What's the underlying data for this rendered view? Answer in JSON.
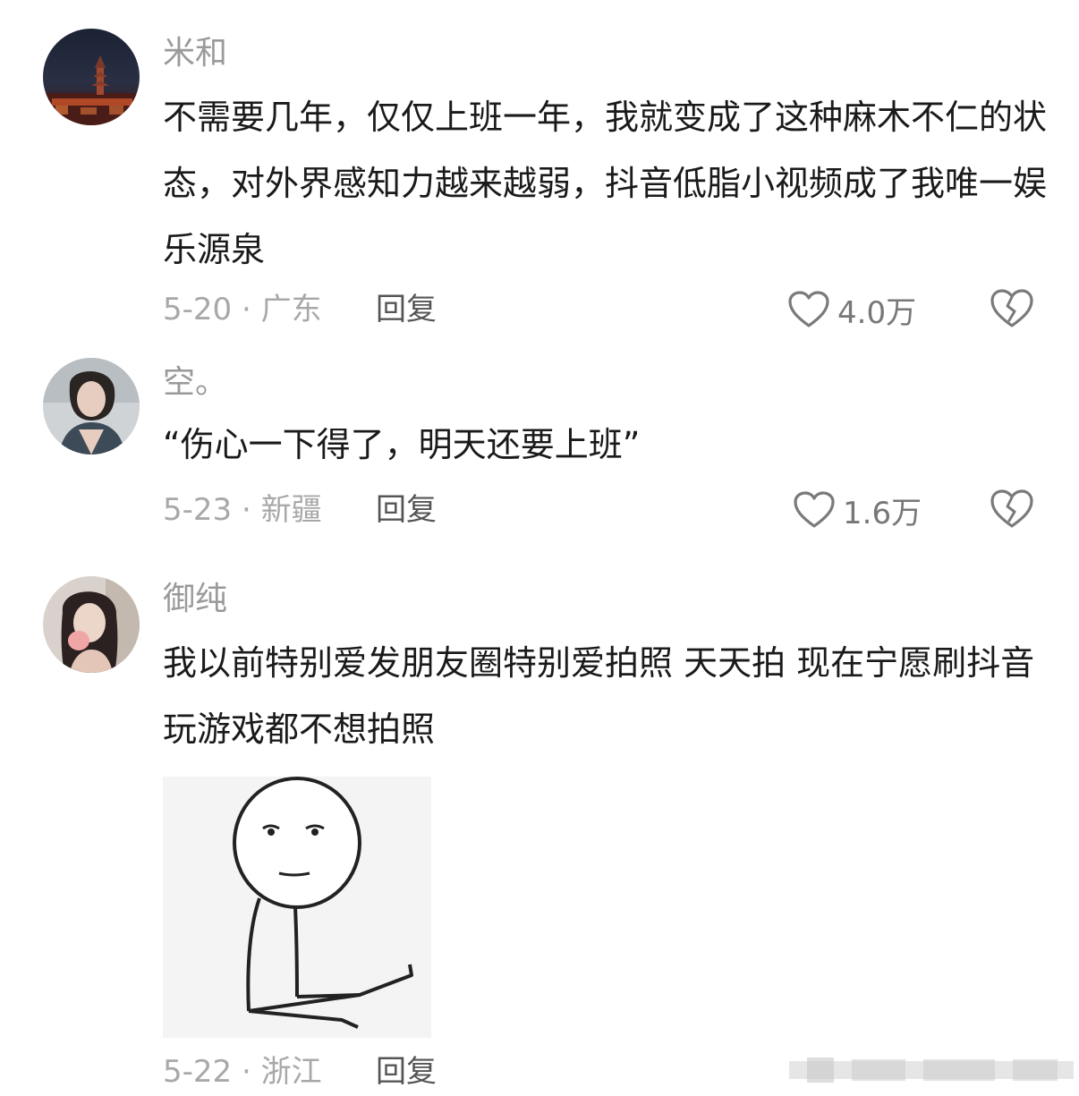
{
  "comments": [
    {
      "username": "米和",
      "text": "不需要几年，仅仅上班一年，我就变成了这种麻木不仁的状态，对外界感知力越来越弱，抖音低脂小视频成了我唯一娱乐源泉",
      "meta": "5-20 · 广东",
      "reply_label": "回复",
      "likes": "4.0万"
    },
    {
      "username": "空。",
      "text": "“伤心一下得了，明天还要上班”",
      "meta": "5-23 · 新疆",
      "reply_label": "回复",
      "likes": "1.6万"
    },
    {
      "username": "御纯",
      "text": "我以前特别爱发朋友圈特别爱拍照 天天拍 现在宁愿刷抖音玩游戏都不想拍照",
      "meta": "5-22 · 浙江",
      "reply_label": "回复",
      "likes": ""
    }
  ],
  "icons": {
    "like": "heart-outline-icon",
    "dislike": "broken-heart-icon"
  },
  "colors": {
    "username": "#9a9a9a",
    "body": "#1a1a1a",
    "meta": "#a8a8a8",
    "reply": "#555555"
  }
}
